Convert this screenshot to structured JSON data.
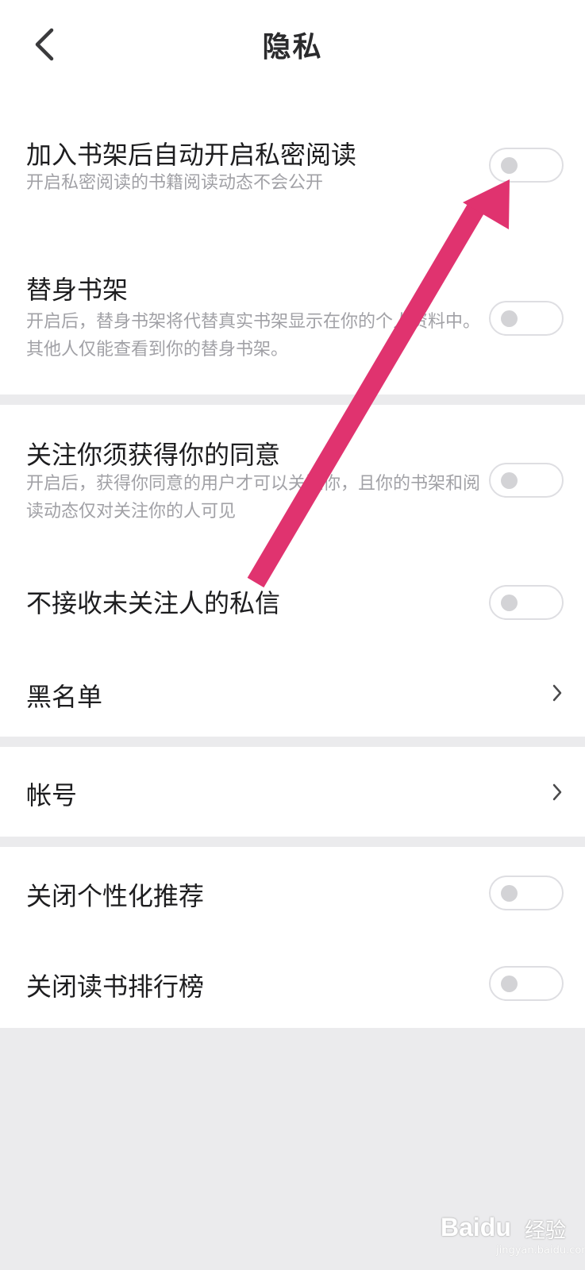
{
  "header": {
    "title": "隐私",
    "back_icon": "chevron-left-icon"
  },
  "settings": {
    "private_reading": {
      "title": "加入书架后自动开启私密阅读",
      "desc": "开启私密阅读的书籍阅读动态不会公开",
      "enabled": false
    },
    "avatar_shelf": {
      "title": "替身书架",
      "desc": "开启后，替身书架将代替真实书架显示在你的个人资料中。其他人仅能查看到你的替身书架。",
      "enabled": false
    },
    "follow_consent": {
      "title": "关注你须获得你的同意",
      "desc": "开启后，获得你同意的用户才可以关注你，且你的书架和阅读动态仅对关注你的人可见",
      "enabled": false
    },
    "block_stranger_dm": {
      "title": "不接收未关注人的私信",
      "enabled": false
    },
    "blacklist": {
      "title": "黑名单"
    },
    "account": {
      "title": "帐号"
    },
    "disable_personalized": {
      "title": "关闭个性化推荐",
      "enabled": false
    },
    "disable_ranking": {
      "title": "关闭读书排行榜",
      "enabled": false
    }
  },
  "annotation": {
    "color": "#e0336f",
    "icon": "arrow-annotation"
  },
  "watermark": {
    "brand": "Bai",
    "brand_paw": "du",
    "brand_cn": "经验",
    "url": "jingyan.baidu.com"
  }
}
